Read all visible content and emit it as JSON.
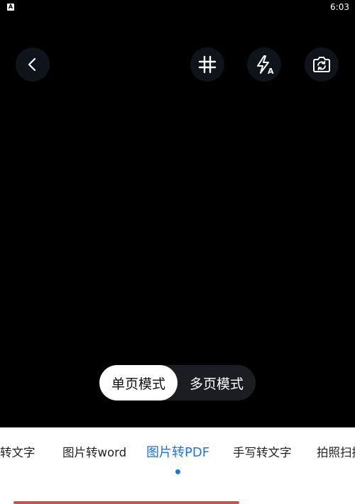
{
  "status_bar": {
    "app_icon_letter": "A",
    "time": "6:03"
  },
  "toolbar": {
    "back_icon": "chevron-left-icon",
    "grid_icon": "grid-hash-icon",
    "flash_icon": "flash-auto-icon",
    "flash_auto_letter": "A",
    "camera_switch_icon": "camera-switch-icon"
  },
  "mode_toggle": {
    "single_label": "单页模式",
    "multi_label": "多页模式",
    "selected": "单页模式"
  },
  "tabs": [
    {
      "label": "转文字"
    },
    {
      "label": "图片转word"
    },
    {
      "label": "图片转PDF",
      "active": true
    },
    {
      "label": "手写转文字"
    },
    {
      "label": "拍照扫描"
    }
  ],
  "colors": {
    "accent": "#1976e6",
    "indicator": "#e04a45",
    "background": "#000000"
  }
}
